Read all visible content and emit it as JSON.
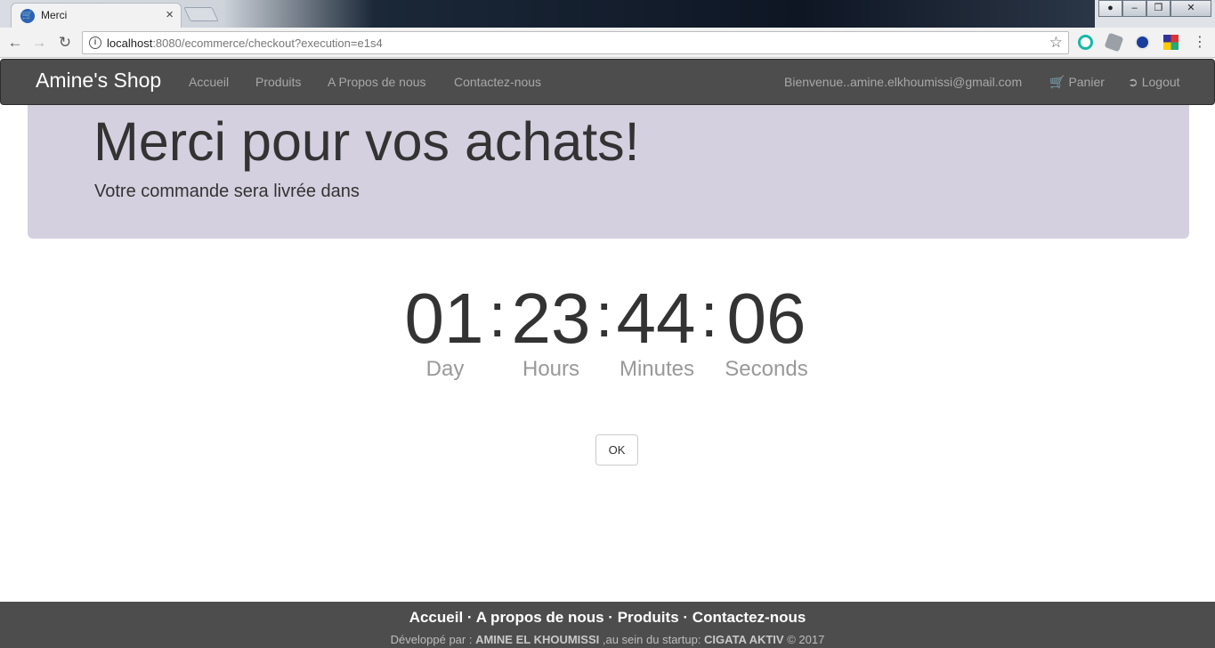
{
  "browser": {
    "tab_title": "Merci",
    "url_host": "localhost",
    "url_rest": ":8080/ecommerce/checkout?execution=e1s4"
  },
  "navbar": {
    "brand": "Amine's Shop",
    "links": [
      "Accueil",
      "Produits",
      "A Propos de nous",
      "Contactez-nous"
    ],
    "welcome": "Bienvenue..amine.elkhoumissi@gmail.com",
    "cart": "Panier",
    "logout": "Logout"
  },
  "jumbotron": {
    "title": "Merci pour vos achats!",
    "subtitle": "Votre commande sera livrée dans"
  },
  "countdown": {
    "day": "01",
    "hours": "23",
    "minutes": "44",
    "seconds": "06",
    "separator": ":",
    "labels": {
      "day": "Day",
      "hours": "Hours",
      "minutes": "Minutes",
      "seconds": "Seconds"
    }
  },
  "ok_button": "OK",
  "footer": {
    "links": [
      "Accueil",
      "A propos de nous",
      "Produits",
      "Contactez-nous"
    ],
    "separator": "·",
    "credit_prefix": "Développé par : ",
    "author": "AMINE EL KHOUMISSI",
    "credit_middle": " ,au sein du startup: ",
    "startup": "CIGATA AKTIV",
    "credit_suffix": " © 2017"
  }
}
